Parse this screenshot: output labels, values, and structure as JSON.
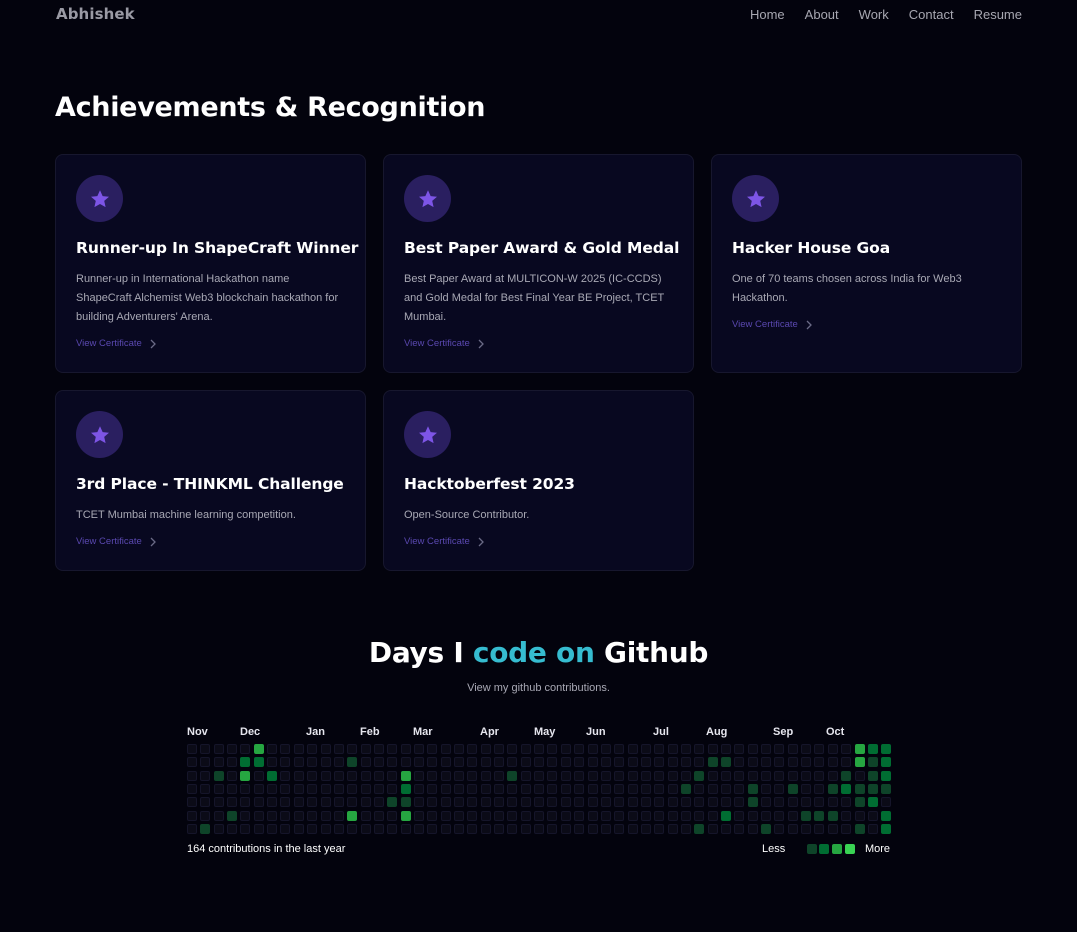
{
  "nav": {
    "brand": "Abhishek",
    "links": [
      "Home",
      "About",
      "Work",
      "Contact",
      "Resume"
    ]
  },
  "achievements": {
    "title": "Achievements & Recognition",
    "link_label": "View Certificate",
    "cards": [
      {
        "title": "Runner-up In ShapeCraft Winner",
        "desc": "Runner-up in International Hackathon name ShapeCraft Alchemist Web3 blockchain hackathon for building Adventurers' Arena.",
        "icon": "star-icon"
      },
      {
        "title": "Best Paper Award & Gold Medal",
        "desc": "Best Paper Award at MULTICON-W 2025 (IC-CCDS) and Gold Medal for Best Final Year BE Project, TCET Mumbai.",
        "icon": "star-icon"
      },
      {
        "title": "Hacker House Goa",
        "desc": "One of 70 teams chosen across India for Web3 Hackathon.",
        "icon": "star-icon"
      },
      {
        "title": "3rd Place - THINKML Challenge",
        "desc": "TCET Mumbai machine learning competition.",
        "icon": "star-icon"
      },
      {
        "title": "Hacktoberfest 2023",
        "desc": "Open-Source Contributor.",
        "icon": "star-icon"
      }
    ]
  },
  "github": {
    "title_pre": "Days I ",
    "title_highlight": "code on",
    "title_post": " Github",
    "subtitle": "View my github contributions.",
    "months": [
      "Nov",
      "Dec",
      "Jan",
      "Feb",
      "Mar",
      "Apr",
      "May",
      "Jun",
      "Jul",
      "Aug",
      "Sep",
      "Oct"
    ],
    "summary": "164 contributions in the last year",
    "legend_less": "Less",
    "legend_more": "More",
    "weeks": 53,
    "active_cells": [
      [
        1,
        6,
        1
      ],
      [
        2,
        2,
        1
      ],
      [
        3,
        5,
        1
      ],
      [
        4,
        1,
        2
      ],
      [
        4,
        2,
        3
      ],
      [
        5,
        0,
        3
      ],
      [
        5,
        1,
        2
      ],
      [
        6,
        2,
        2
      ],
      [
        12,
        1,
        1
      ],
      [
        12,
        5,
        3
      ],
      [
        15,
        4,
        1
      ],
      [
        16,
        2,
        3
      ],
      [
        16,
        3,
        2
      ],
      [
        16,
        4,
        1
      ],
      [
        16,
        5,
        3
      ],
      [
        24,
        2,
        1
      ],
      [
        37,
        3,
        1
      ],
      [
        38,
        2,
        1
      ],
      [
        38,
        6,
        1
      ],
      [
        39,
        1,
        1
      ],
      [
        40,
        1,
        1
      ],
      [
        40,
        5,
        2
      ],
      [
        42,
        3,
        1
      ],
      [
        42,
        4,
        1
      ],
      [
        43,
        6,
        1
      ],
      [
        45,
        3,
        1
      ],
      [
        46,
        5,
        1
      ],
      [
        47,
        5,
        1
      ],
      [
        48,
        3,
        1
      ],
      [
        48,
        5,
        1
      ],
      [
        49,
        2,
        1
      ],
      [
        49,
        3,
        2
      ],
      [
        50,
        0,
        3
      ],
      [
        50,
        1,
        3
      ],
      [
        50,
        3,
        1
      ],
      [
        50,
        4,
        1
      ],
      [
        50,
        6,
        1
      ],
      [
        51,
        0,
        2
      ],
      [
        51,
        1,
        1
      ],
      [
        51,
        2,
        1
      ],
      [
        51,
        3,
        1
      ],
      [
        51,
        4,
        2
      ],
      [
        52,
        0,
        2
      ],
      [
        52,
        1,
        2
      ],
      [
        52,
        2,
        2
      ],
      [
        52,
        3,
        1
      ],
      [
        52,
        5,
        2
      ],
      [
        52,
        6,
        2
      ]
    ],
    "colors": {
      "empty": "#0b0b17",
      "level1": "#0e4429",
      "level2": "#006d32",
      "level3": "#26a641",
      "level4": "#39d353",
      "accent": "#36bcd0",
      "star": "#7d55e6"
    }
  }
}
